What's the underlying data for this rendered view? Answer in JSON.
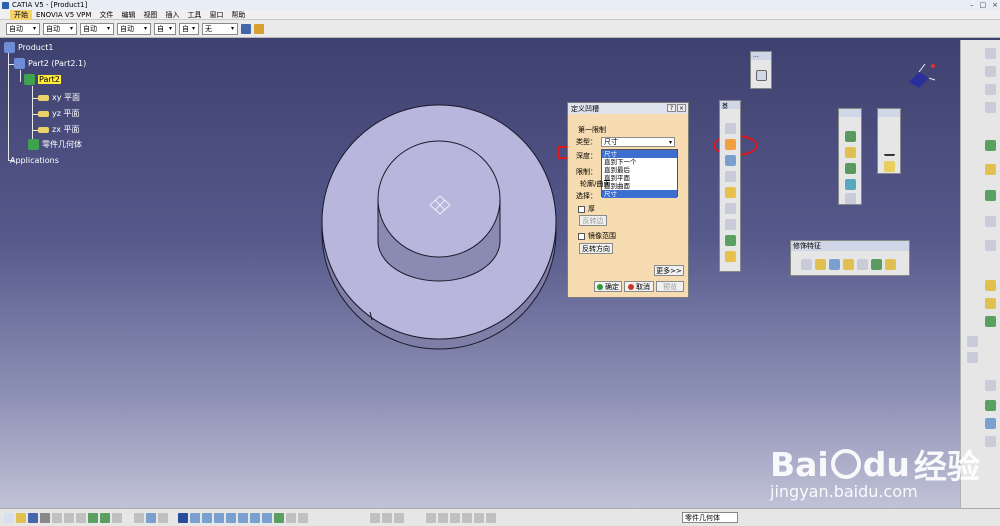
{
  "window": {
    "title": "CATIA V5 - [Product1]"
  },
  "menubar": {
    "items": [
      "开始",
      "ENOVIA V5 VPM",
      "文件",
      "编辑",
      "视图",
      "插入",
      "工具",
      "窗口",
      "帮助"
    ]
  },
  "top_toolbar": {
    "combos": [
      "自动",
      "自动",
      "自动",
      "自动",
      "自",
      "自",
      "无"
    ]
  },
  "tree": {
    "root": "Product1",
    "part": "Part2 (Part2.1)",
    "body": "Part2",
    "children": [
      "xy 平面",
      "yz 平面",
      "zx 平面",
      "零件几何体"
    ],
    "applications": "Applications"
  },
  "dialog": {
    "title": "定义凹槽",
    "group_label": "第一限制",
    "type_label": "类型：",
    "type_value": "尺寸",
    "depth_label": "深度：",
    "depth_value": "尺寸",
    "limit_label": "限制：",
    "profile_label": "轮廓/曲面",
    "select_label": "选择：",
    "dropdown_options": [
      "尺寸",
      "直到下一个",
      "直到最后",
      "直到平面",
      "直到曲面",
      "尺寸"
    ],
    "thick_label": "厚",
    "reverse_side": "反转边",
    "mirror_label": "镜像范围",
    "reverse_dir": "反转方向",
    "more": "更多>>",
    "ok": "确定",
    "cancel": "取消",
    "preview": "预览"
  },
  "palettes": {
    "sketch_hdr": "...",
    "features_hdr": "基",
    "dressup_title": "修饰特征"
  },
  "bottom": {
    "combo_value": "零件几何体"
  },
  "watermark": {
    "brand": "Bai",
    "brand_suffix": "du",
    "brand_cn": "经验",
    "url": "jingyan.baidu.com"
  },
  "colors": {
    "highlight": "#e0141a",
    "background_top": "#3a3d6a",
    "part_face": "#b8b6dc"
  }
}
